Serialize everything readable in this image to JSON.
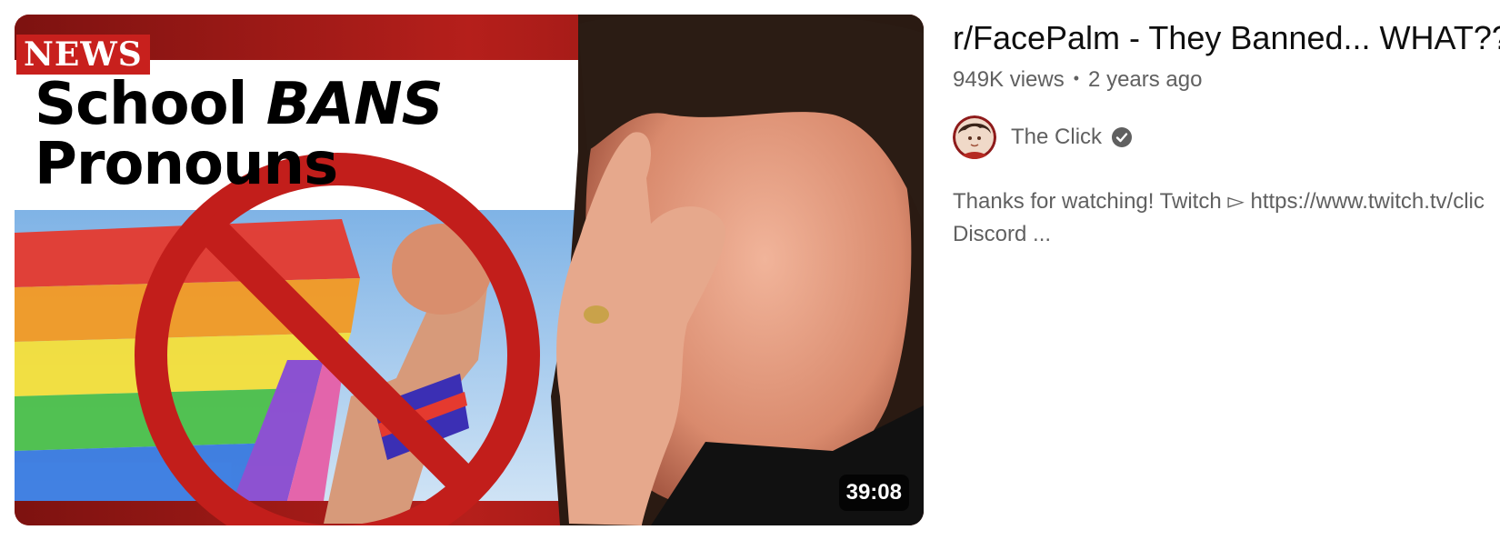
{
  "video": {
    "thumbnail": {
      "badge": "NEWS",
      "headline_line1_word1": "School",
      "headline_line1_word2": "BANS",
      "headline_line2": "Pronouns",
      "duration": "39:08"
    },
    "title": "r/FacePalm - They Banned... WHAT??",
    "views": "949K views",
    "separator": "•",
    "age": "2 years ago",
    "channel": {
      "name": "The Click",
      "verified_icon": "verified-check-icon"
    },
    "description_line1": "Thanks for watching! Twitch ▻ https://www.twitch.tv/clic",
    "description_line2": "Discord ..."
  },
  "colors": {
    "title_text": "#0f0f0f",
    "secondary_text": "#606060",
    "badge_red": "#c8201d",
    "thumb_red": "#9b1a17"
  }
}
